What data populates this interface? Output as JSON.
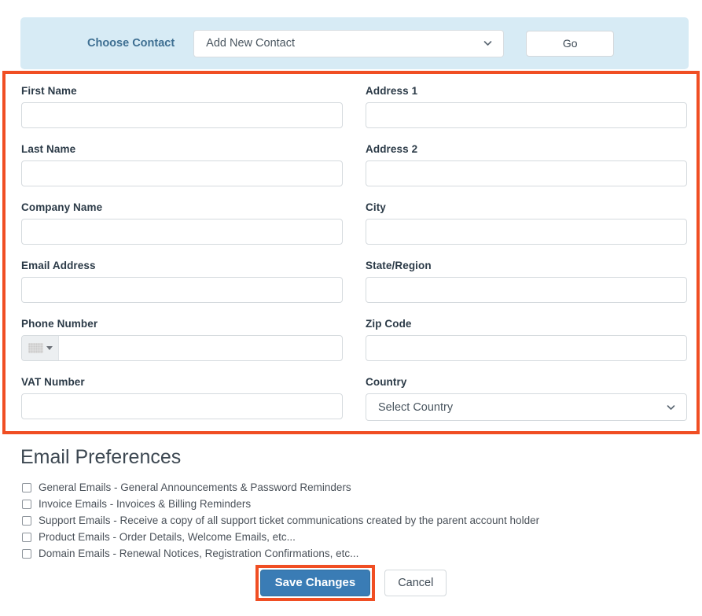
{
  "banner": {
    "label": "Choose Contact",
    "select_value": "Add New Contact",
    "chevron_icon": "chevron-down-icon",
    "go_label": "Go"
  },
  "form": {
    "left_fields": [
      {
        "label": "First Name",
        "value": "",
        "type": "text"
      },
      {
        "label": "Last Name",
        "value": "",
        "type": "text"
      },
      {
        "label": "Company Name",
        "value": "",
        "type": "text"
      },
      {
        "label": "Email Address",
        "value": "",
        "type": "text"
      },
      {
        "label": "Phone Number",
        "value": "",
        "type": "phone"
      },
      {
        "label": "VAT Number",
        "value": "",
        "type": "text"
      }
    ],
    "right_fields": [
      {
        "label": "Address 1",
        "value": "",
        "type": "text"
      },
      {
        "label": "Address 2",
        "value": "",
        "type": "text"
      },
      {
        "label": "City",
        "value": "",
        "type": "text"
      },
      {
        "label": "State/Region",
        "value": "",
        "type": "text"
      },
      {
        "label": "Zip Code",
        "value": "",
        "type": "text"
      },
      {
        "label": "Country",
        "value": "Select Country",
        "type": "select"
      }
    ],
    "phone_flag_icon": "flag-placeholder-icon",
    "phone_caret_icon": "caret-down-icon",
    "country_chevron_icon": "chevron-down-icon",
    "highlight_color": "#f04e23"
  },
  "preferences": {
    "title": "Email Preferences",
    "items": [
      {
        "label": "General Emails - General Announcements & Password Reminders",
        "checked": false
      },
      {
        "label": "Invoice Emails - Invoices & Billing Reminders",
        "checked": false
      },
      {
        "label": "Support Emails - Receive a copy of all support ticket communications created by the parent account holder",
        "checked": false
      },
      {
        "label": "Product Emails - Order Details, Welcome Emails, etc...",
        "checked": false
      },
      {
        "label": "Domain Emails - Renewal Notices, Registration Confirmations, etc...",
        "checked": false
      }
    ]
  },
  "actions": {
    "save_label": "Save Changes",
    "cancel_label": "Cancel",
    "save_color": "#3a7cb5",
    "highlight_color": "#f04e23"
  }
}
